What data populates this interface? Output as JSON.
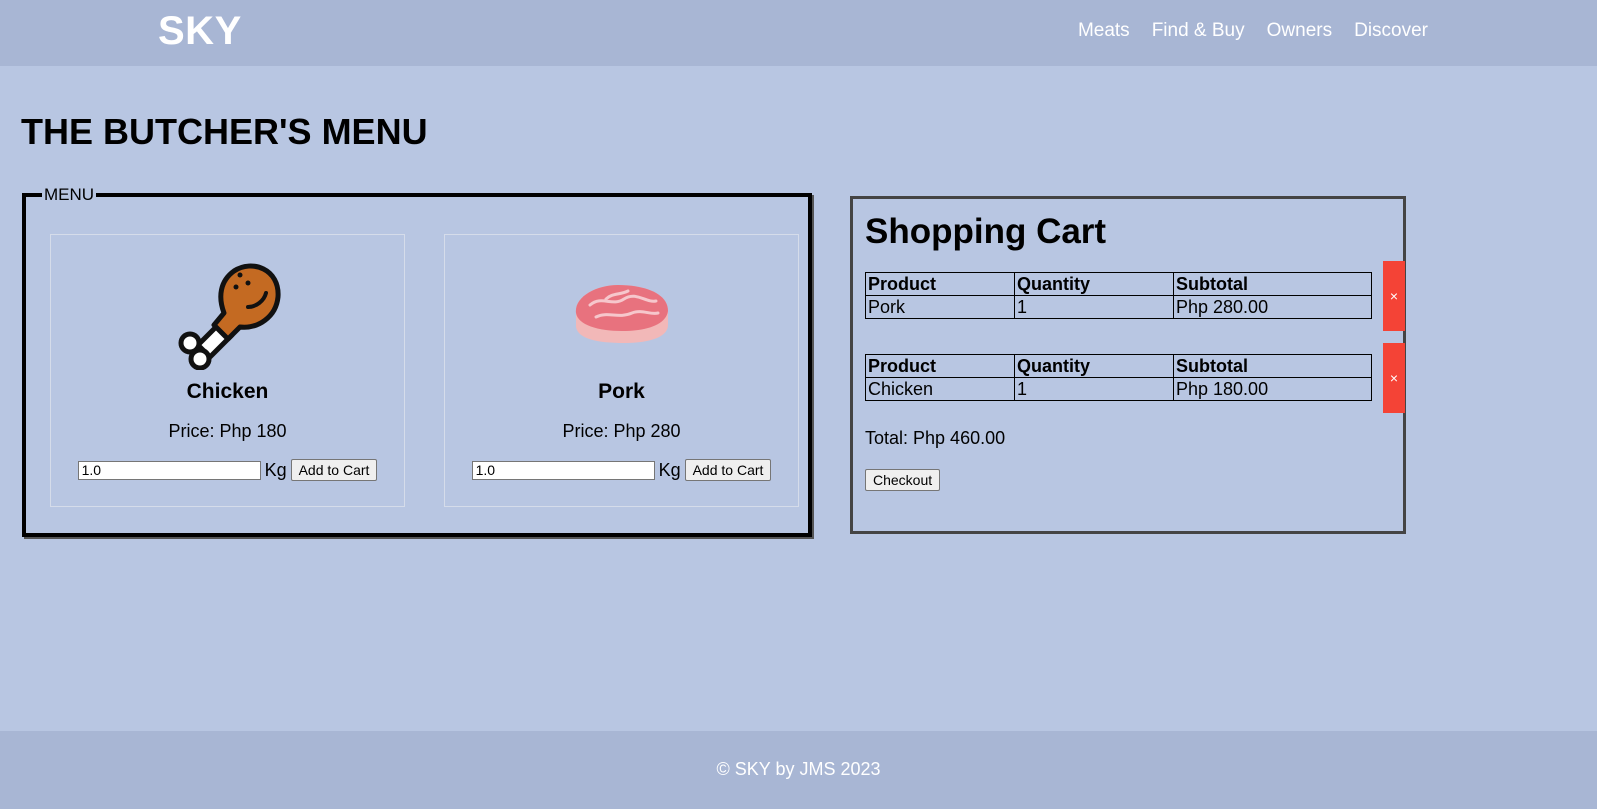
{
  "header": {
    "logo": "SKY",
    "nav": [
      "Meats",
      "Find & Buy",
      "Owners",
      "Discover"
    ]
  },
  "page_title": "THE BUTCHER'S MENU",
  "menu": {
    "legend": "MENU",
    "products": [
      {
        "name": "Chicken",
        "price": "Price: Php 180",
        "qty": "1.0",
        "unit": "Kg",
        "button": "Add to Cart",
        "icon": "chicken-leg-icon"
      },
      {
        "name": "Pork",
        "price": "Price: Php 280",
        "qty": "1.0",
        "unit": "Kg",
        "button": "Add to Cart",
        "icon": "pork-meat-icon"
      }
    ]
  },
  "cart": {
    "title": "Shopping Cart",
    "headers": [
      "Product",
      "Quantity",
      "Subtotal"
    ],
    "items": [
      {
        "product": "Pork",
        "quantity": "1",
        "subtotal": "Php 280.00",
        "remove": "×"
      },
      {
        "product": "Chicken",
        "quantity": "1",
        "subtotal": "Php 180.00",
        "remove": "×"
      }
    ],
    "total": "Total: Php 460.00",
    "checkout": "Checkout"
  },
  "footer": "© SKY by JMS 2023",
  "colors": {
    "background": "#b8c6e2",
    "header": "#a8b6d4",
    "remove": "#f44336"
  }
}
